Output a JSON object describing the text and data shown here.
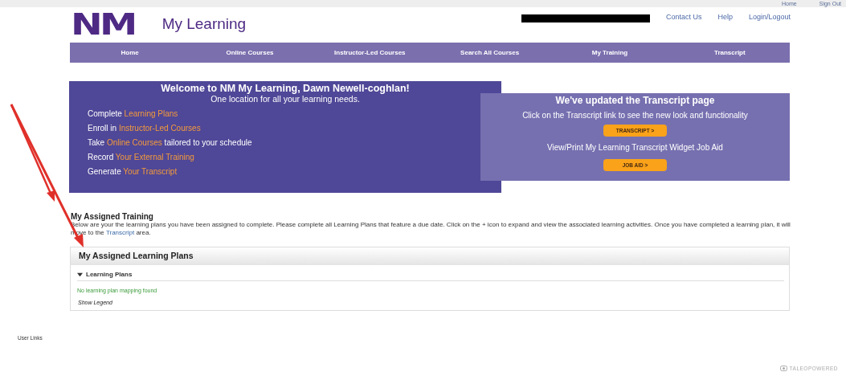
{
  "top_bar": {
    "links": [
      "Home",
      "Sign Out"
    ]
  },
  "header": {
    "logo": "NM",
    "title": "My Learning",
    "links": [
      "Contact Us",
      "Help",
      "Login/Logout"
    ]
  },
  "nav": [
    "Home",
    "Online Courses",
    "Instructor-Led Courses",
    "Search All Courses",
    "My Training",
    "Transcript"
  ],
  "welcome": {
    "title": "Welcome to NM My Learning, Dawn Newell-coghlan!",
    "subtitle": "One location for all your learning needs.",
    "lines": [
      {
        "before": "Complete",
        "link": "Learning Plans"
      },
      {
        "before": "Enroll in",
        "link": "Instructor-Led Courses"
      },
      {
        "before": "Take",
        "link": "Online Courses",
        "after": "tailored to your schedule"
      },
      {
        "before": "Record",
        "link": "Your External Training"
      },
      {
        "before": "Generate",
        "link": "Your Transcript"
      }
    ]
  },
  "update": {
    "title": "We've updated the Transcript page",
    "text": "Click on the Transcript link to see the new look and functionality",
    "button": "TRANSCRIPT >",
    "job_aid_text": "View/Print My Learning Transcript Widget Job Aid",
    "job_aid_button": "JOB AID >"
  },
  "assigned": {
    "heading": "My Assigned Training",
    "description_before": "Below are your the learning plans you have been assigned to complete.  Please complete all Learning Plans that feature a due date.  Click on the + icon to expand and view the associated learning activities.  Once you have completed a learning plan, it will move to the",
    "link": "Transcript",
    "description_after": "area."
  },
  "panel": {
    "title": "My Assigned Learning Plans",
    "section": {
      "label": "Learning Plans",
      "expanded": true
    },
    "empty_message": "No learning plan mapping found",
    "legend_link": "Show Legend"
  },
  "footer": {
    "user_links": "User Links",
    "powered": "TALEOPOWERED"
  }
}
